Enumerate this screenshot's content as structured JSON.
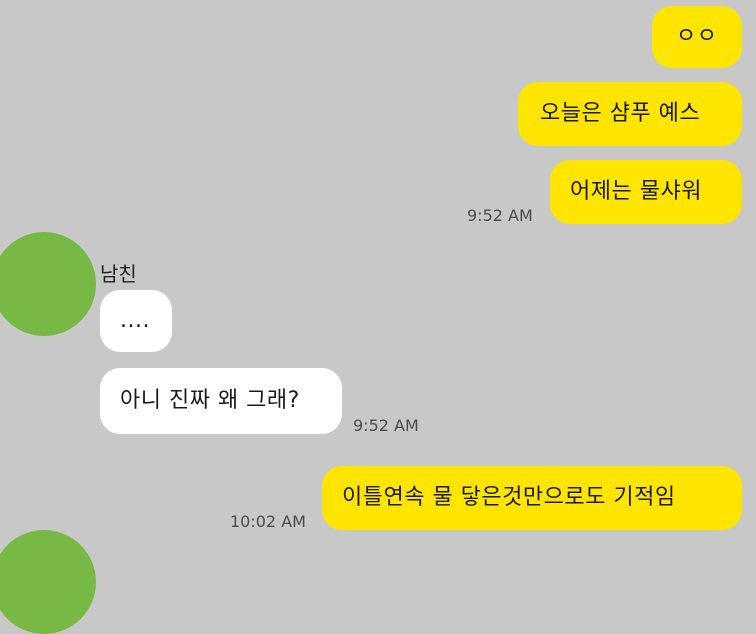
{
  "colors": {
    "background": "#c8c8c8",
    "my_bubble": "#fee500",
    "their_bubble": "#ffffff",
    "avatar": "#77b944"
  },
  "messages": {
    "m1": {
      "text": "ㅇㅇ"
    },
    "m2": {
      "text": "오늘은 샴푸 예스"
    },
    "m3": {
      "text": "어제는 물샤워",
      "time": "9:52 AM"
    },
    "sender_name": "남친",
    "m4": {
      "text": "...."
    },
    "m5": {
      "text": "아니 진짜 왜 그래?",
      "time": "9:52 AM"
    },
    "m6": {
      "text": "이틀연속 물 닿은것만으로도 기적임",
      "time": "10:02 AM"
    }
  }
}
